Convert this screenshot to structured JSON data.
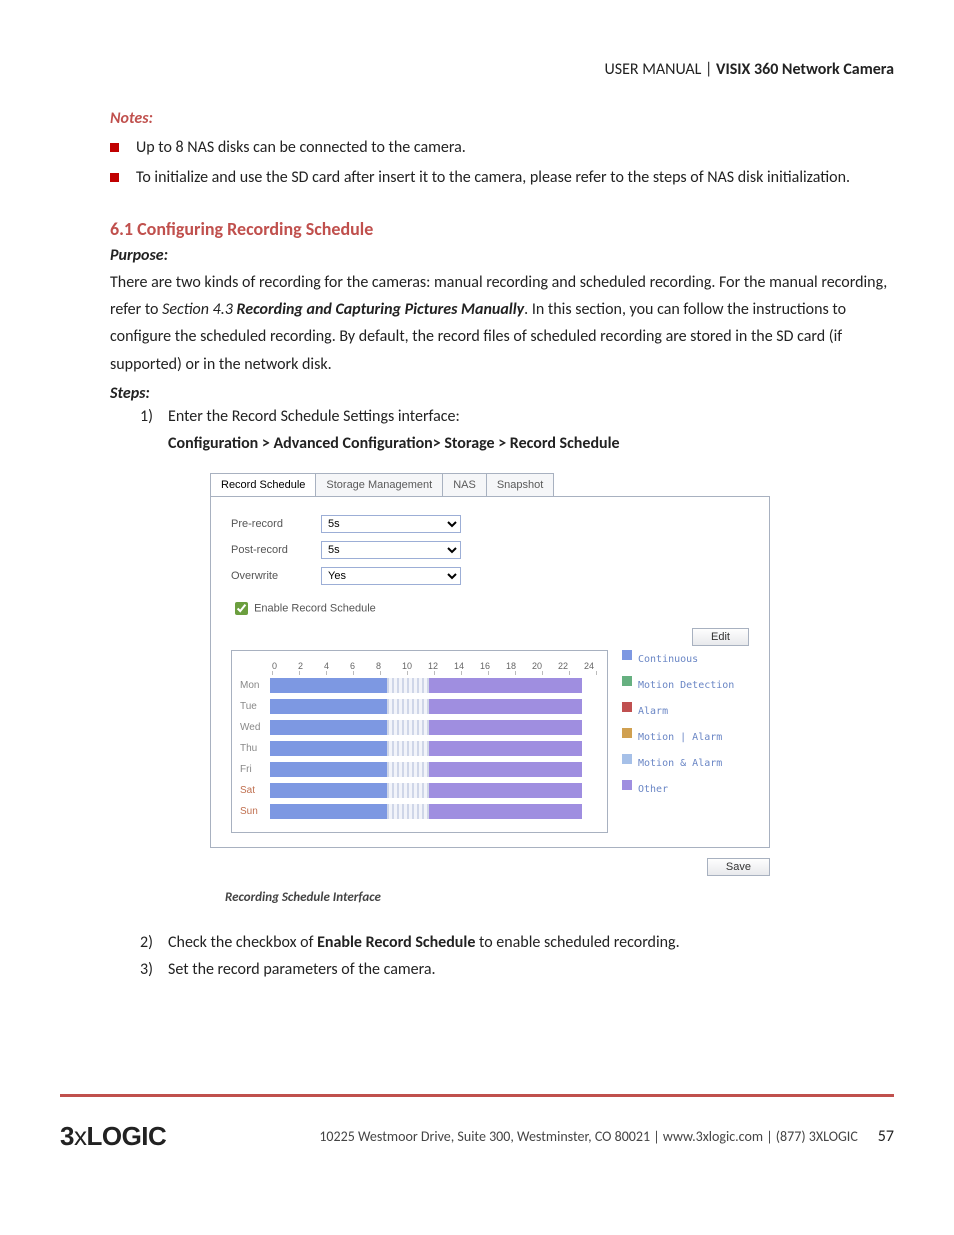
{
  "header": {
    "left": "USER MANUAL | ",
    "right": "VISIX 360 Network Camera"
  },
  "notes": {
    "title": "Notes:",
    "items": [
      "Up to 8 NAS disks can be connected to the camera.",
      "To initialize and use the SD card after insert it to the camera, please refer to the steps of NAS disk initialization."
    ]
  },
  "section": {
    "heading": "6.1 Configuring Recording Schedule",
    "purpose_label": "Purpose:",
    "purpose_text_1": "There are two kinds of recording for the cameras: manual recording and scheduled recording. For the manual recording, refer to ",
    "purpose_ref": "Section 4.3",
    "purpose_ref_title": " Recording and Capturing Pictures Manually",
    "purpose_text_2": ". In this section, you can follow the instructions to configure the scheduled recording. By default, the record files of scheduled recording are stored in the SD card (if supported) or in the network disk.",
    "steps_label": "Steps:",
    "step1_a": "Enter the Record Schedule Settings interface:",
    "step1_b": "Configuration > Advanced Configuration> Storage > Record Schedule",
    "step2_a": "Check the checkbox of ",
    "step2_b": "Enable Record Schedule",
    "step2_c": " to enable scheduled recording.",
    "step3": "Set the record parameters of the camera."
  },
  "fig": {
    "tabs": [
      "Record Schedule",
      "Storage Management",
      "NAS",
      "Snapshot"
    ],
    "fields": {
      "prerecord": {
        "label": "Pre-record",
        "value": "5s"
      },
      "postrecord": {
        "label": "Post-record",
        "value": "5s"
      },
      "overwrite": {
        "label": "Overwrite",
        "value": "Yes"
      }
    },
    "enable_label": "Enable Record Schedule",
    "edit_btn": "Edit",
    "hours": [
      "0",
      "2",
      "4",
      "6",
      "8",
      "10",
      "12",
      "14",
      "16",
      "18",
      "20",
      "22",
      "24"
    ],
    "days": [
      "Mon",
      "Tue",
      "Wed",
      "Thu",
      "Fri",
      "Sat",
      "Sun"
    ],
    "legend": [
      {
        "color": "#7d98e2",
        "text": "Continuous"
      },
      {
        "color": "#66b080",
        "text": "Motion Detection"
      },
      {
        "color": "#c05050",
        "text": "Alarm"
      },
      {
        "color": "#d0a050",
        "text": "Motion | Alarm"
      },
      {
        "color": "#a6c0e8",
        "text": "Motion & Alarm"
      },
      {
        "color": "#9f8ee0",
        "text": "Other"
      }
    ],
    "save_btn": "Save",
    "caption": "Recording Schedule Interface"
  },
  "footer": {
    "logo": "3xLOGIC",
    "text": "10225 Westmoor Drive, Suite 300, Westminster, CO 80021 | www.3xlogic.com | (877) 3XLOGIC",
    "page": "57"
  }
}
